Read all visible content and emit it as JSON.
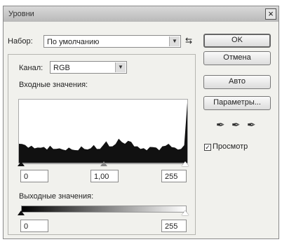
{
  "window": {
    "title": "Уровни",
    "close_glyph": "×"
  },
  "preset": {
    "label": "Набор:",
    "value": "По умолчанию",
    "menu_glyph": "⇆"
  },
  "channel": {
    "label": "Канал:",
    "value": "RGB"
  },
  "input": {
    "label": "Входные значения:",
    "black": "0",
    "gamma": "1,00",
    "white": "255"
  },
  "output": {
    "label": "Выходные значения:",
    "black": "0",
    "white": "255"
  },
  "buttons": {
    "ok": "OK",
    "cancel": "Отмена",
    "auto": "Авто",
    "options": "Параметры..."
  },
  "preview": {
    "label": "Просмотр",
    "checked": true,
    "check_glyph": "✓"
  },
  "eyedroppers": {
    "glyph": "✒",
    "names": [
      "black-point",
      "gray-point",
      "white-point"
    ]
  },
  "dropdown_glyph": "▼",
  "histogram": {
    "levels": [
      0.3,
      0.32,
      0.28,
      0.26,
      0.27,
      0.25,
      0.24,
      0.26,
      0.25,
      0.23,
      0.27,
      0.24,
      0.22,
      0.25,
      0.21,
      0.22,
      0.24,
      0.23,
      0.2,
      0.22,
      0.26,
      0.24,
      0.21,
      0.25,
      0.28,
      0.24,
      0.22,
      0.3,
      0.34,
      0.28,
      0.26,
      0.32,
      0.38,
      0.35,
      0.3,
      0.37,
      0.33,
      0.28,
      0.26,
      0.24,
      0.23,
      0.22,
      0.25,
      0.27,
      0.24,
      0.22,
      0.26,
      0.29,
      0.3,
      0.27,
      0.24,
      0.23,
      0.22,
      0.3,
      0.95
    ]
  }
}
